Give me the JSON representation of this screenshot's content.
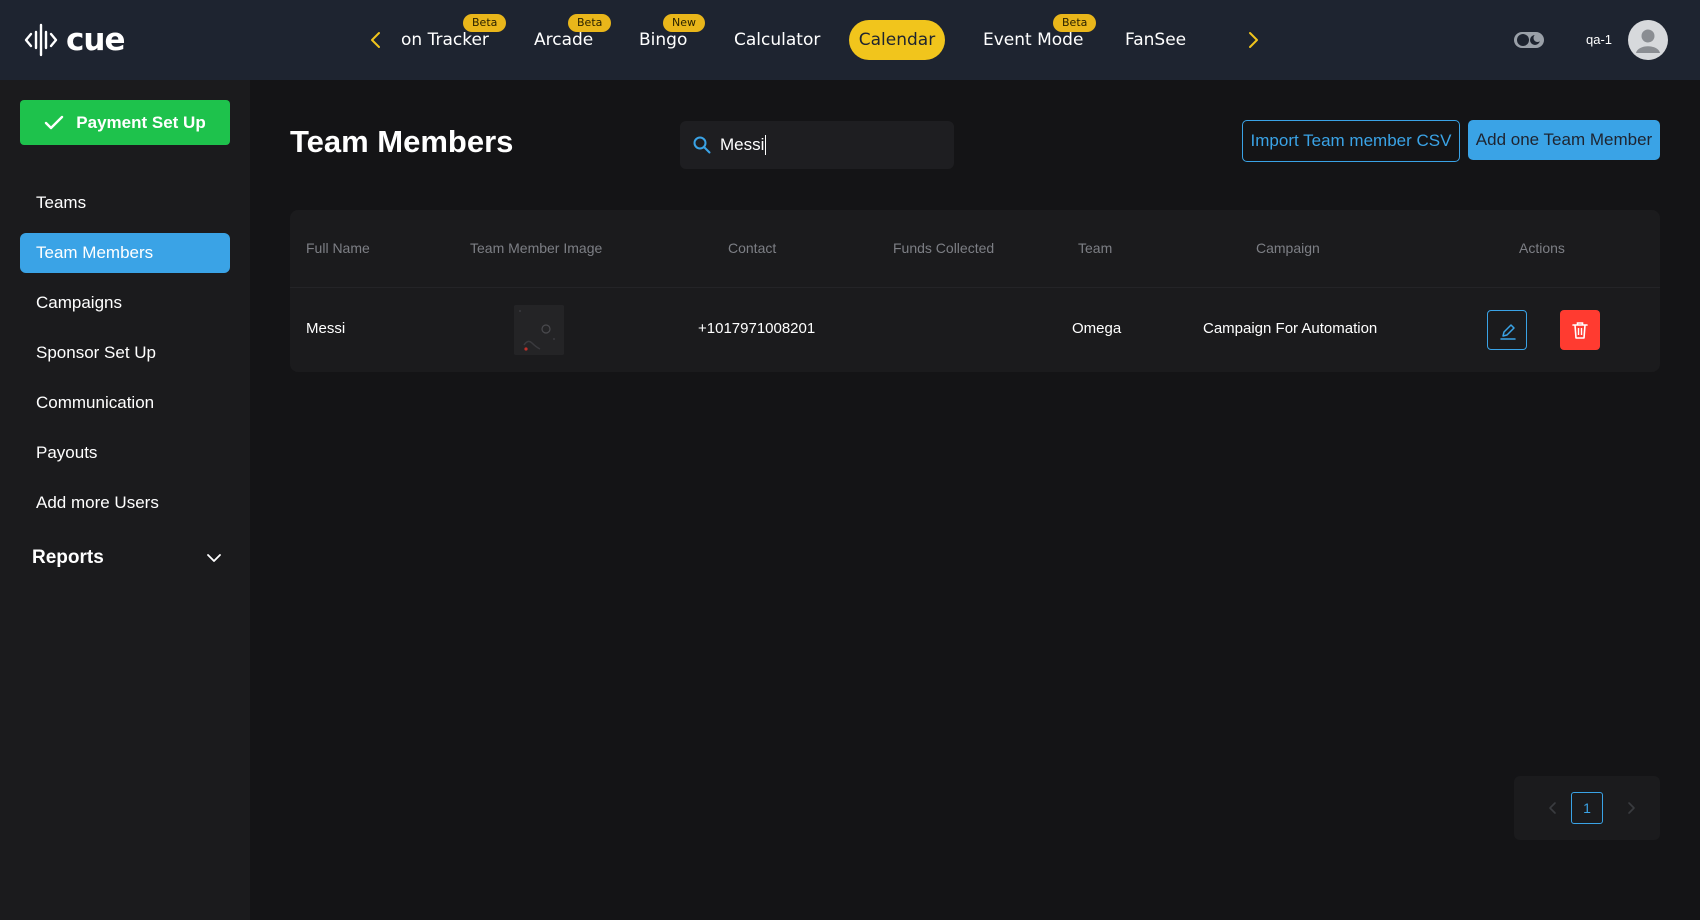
{
  "app": {
    "logo_text": "cue"
  },
  "topnav": {
    "items": [
      {
        "label": "on Tracker",
        "badge": "Beta"
      },
      {
        "label": "Arcade",
        "badge": "Beta"
      },
      {
        "label": "Bingo",
        "badge": "New"
      },
      {
        "label": "Calculator",
        "badge": ""
      },
      {
        "label": "Calendar",
        "badge": "",
        "active": true
      },
      {
        "label": "Event Mode",
        "badge": "Beta"
      },
      {
        "label": "FanSee",
        "badge": ""
      }
    ],
    "user": "qa-1"
  },
  "sidebar": {
    "payment_button": "Payment Set Up",
    "items": [
      {
        "label": "Teams"
      },
      {
        "label": "Team Members",
        "active": true
      },
      {
        "label": "Campaigns"
      },
      {
        "label": "Sponsor Set Up"
      },
      {
        "label": "Communication"
      },
      {
        "label": "Payouts"
      },
      {
        "label": "Add more Users"
      }
    ],
    "reports_label": "Reports"
  },
  "main": {
    "title": "Team Members",
    "search": {
      "value": "Messi",
      "placeholder": ""
    },
    "import_button": "Import Team member CSV",
    "add_button": "Add one Team Member"
  },
  "table": {
    "columns": [
      "Full Name",
      "Team Member Image",
      "Contact",
      "Funds Collected",
      "Team",
      "Campaign",
      "Actions"
    ],
    "rows": [
      {
        "full_name": "Messi",
        "contact": "+1017971008201",
        "funds_collected": "",
        "team": "Omega",
        "campaign": "Campaign For Automation"
      }
    ]
  },
  "pagination": {
    "current_page": "1"
  },
  "colors": {
    "accent_blue": "#3aa3e6",
    "active_yellow": "#f1c51c",
    "success_green": "#1ec24c",
    "danger_red": "#ff3b30",
    "topbar_bg": "#1e2430",
    "page_bg": "#141416"
  },
  "icons": [
    "logo-mark-icon",
    "chevron-left-icon",
    "chevron-right-icon",
    "theme-toggle-icon",
    "user-avatar-icon",
    "checkmark-icon",
    "chevron-down-icon",
    "search-icon",
    "edit-icon",
    "trash-icon"
  ]
}
